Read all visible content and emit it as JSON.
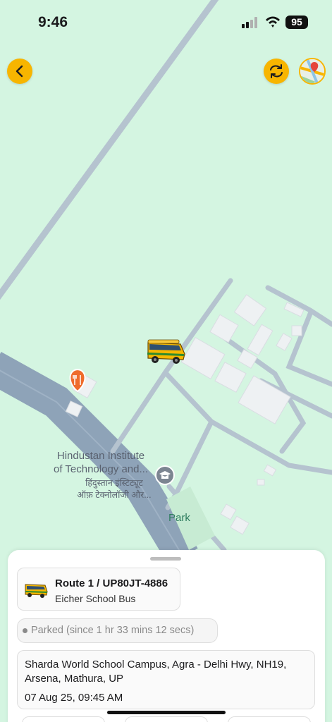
{
  "status_bar": {
    "time": "9:46",
    "battery": "95"
  },
  "map": {
    "poi_label_en": "Hindustan Institute\nof Technology and...",
    "poi_label_hi": "हिंदुस्तान इंस्टिट्यूट\nऑफ़ टेक्नोलॉजी और...",
    "park_label": "Park",
    "background_color": "#d4f5e1",
    "road_color": "#b5c3cf",
    "highway_color": "#8ea3b8",
    "accent_color": "#f7b500"
  },
  "icons": {
    "back": "chevron-left-icon",
    "refresh": "refresh-icon",
    "map_type": "map-layers-icon",
    "restaurant": "fork-knife-icon",
    "school": "graduation-cap-icon",
    "bus": "bus-icon"
  },
  "sheet": {
    "vehicle_title": "Route 1 / UP80JT-4886",
    "vehicle_subtitle": "Eicher School Bus",
    "status": "Parked (since 1 hr 33 mins 12 secs)",
    "address": "Sharda World School Campus, Agra - Delhi Hwy, NH19, Arsena, Mathura, UP",
    "timestamp": "07 Aug 25, 09:45 AM"
  }
}
